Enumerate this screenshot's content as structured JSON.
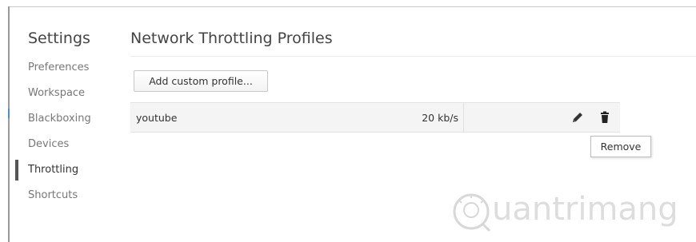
{
  "sidebar": {
    "title": "Settings",
    "items": [
      {
        "label": "Preferences"
      },
      {
        "label": "Workspace"
      },
      {
        "label": "Blackboxing"
      },
      {
        "label": "Devices"
      },
      {
        "label": "Throttling"
      },
      {
        "label": "Shortcuts"
      }
    ],
    "active_item": "Throttling"
  },
  "main": {
    "title": "Network Throttling Profiles",
    "add_button_label": "Add custom profile...",
    "profiles": [
      {
        "name": "youtube",
        "speed": "20 kb/s",
        "actions": [
          "pencil-icon",
          "trash-icon"
        ]
      }
    ],
    "tooltip": "Remove"
  },
  "watermark": {
    "text": "uantrimang",
    "icon": "lightbulb-q-logo"
  },
  "colors": {
    "accent_edge": "#4a8fd6",
    "row_background": "#f4f4f4",
    "text": "#333333",
    "muted_text": "#777777"
  }
}
